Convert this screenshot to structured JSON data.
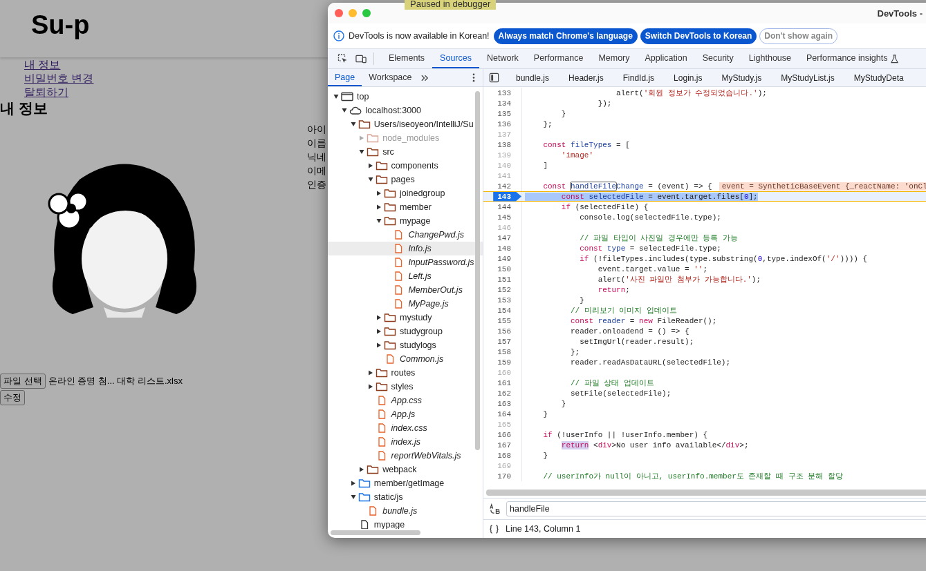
{
  "paused_banner": "Paused in debugger",
  "page": {
    "logo": "Su-p",
    "nav_links": [
      "내 정보",
      "비밀번호 변경",
      "탈퇴하기"
    ],
    "heading": "내 정보",
    "field_labels": [
      "아이",
      "이름",
      "닉네",
      "이메",
      "인증"
    ],
    "file_button": "파일 선택",
    "file_name": "온라인 증명 첨... 대학 리스트.xlsx",
    "submit_button": "수정"
  },
  "devtools": {
    "title": "DevTools -",
    "notice": {
      "text": "DevTools is now available in Korean!",
      "buttons": [
        {
          "label": "Always match Chrome's language",
          "kind": "primary"
        },
        {
          "label": "Switch DevTools to Korean",
          "kind": "primary"
        },
        {
          "label": "Don't show again",
          "kind": "outline"
        }
      ]
    },
    "tabs": [
      {
        "label": "Elements",
        "selected": false
      },
      {
        "label": "Sources",
        "selected": true
      },
      {
        "label": "Network",
        "selected": false
      },
      {
        "label": "Performance",
        "selected": false
      },
      {
        "label": "Memory",
        "selected": false
      },
      {
        "label": "Application",
        "selected": false
      },
      {
        "label": "Security",
        "selected": false
      },
      {
        "label": "Lighthouse",
        "selected": false
      },
      {
        "label": "Performance insights",
        "selected": false
      }
    ],
    "navigator_tabs": [
      {
        "label": "Page",
        "selected": true
      },
      {
        "label": "Workspace",
        "selected": false
      }
    ],
    "editor_tabs": [
      "bundle.js",
      "Header.js",
      "FindId.js",
      "Login.js",
      "MyStudy.js",
      "MyStudyList.js",
      "MyStudyDeta"
    ],
    "tree": [
      {
        "label": "top",
        "kind": "frame",
        "expanded": true,
        "selected": false,
        "dimmed": false,
        "children": [
          {
            "label": "localhost:3000",
            "kind": "cloud",
            "expanded": true,
            "selected": false,
            "dimmed": false,
            "children": [
              {
                "label": "Users/iseoyeon/IntelliJ/Su",
                "kind": "folder",
                "expanded": true,
                "selected": false,
                "dimmed": false,
                "children": [
                  {
                    "label": "node_modules",
                    "kind": "folder",
                    "expanded": false,
                    "selected": false,
                    "dimmed": true
                  },
                  {
                    "label": "src",
                    "kind": "folder",
                    "expanded": true,
                    "selected": false,
                    "dimmed": false,
                    "children": [
                      {
                        "label": "components",
                        "kind": "folder",
                        "expanded": false,
                        "selected": false,
                        "dimmed": false
                      },
                      {
                        "label": "pages",
                        "kind": "folder",
                        "expanded": true,
                        "selected": false,
                        "dimmed": false,
                        "children": [
                          {
                            "label": "joinedgroup",
                            "kind": "folder",
                            "expanded": false,
                            "selected": false,
                            "dimmed": false
                          },
                          {
                            "label": "member",
                            "kind": "folder",
                            "expanded": false,
                            "selected": false,
                            "dimmed": false
                          },
                          {
                            "label": "mypage",
                            "kind": "folder",
                            "expanded": true,
                            "selected": false,
                            "dimmed": false,
                            "children": [
                              {
                                "label": "ChangePwd.js",
                                "kind": "file",
                                "selected": false,
                                "dimmed": false
                              },
                              {
                                "label": "Info.js",
                                "kind": "file",
                                "selected": true,
                                "dimmed": false
                              },
                              {
                                "label": "InputPassword.js",
                                "kind": "file",
                                "selected": false,
                                "dimmed": false
                              },
                              {
                                "label": "Left.js",
                                "kind": "file",
                                "selected": false,
                                "dimmed": false
                              },
                              {
                                "label": "MemberOut.js",
                                "kind": "file",
                                "selected": false,
                                "dimmed": false
                              },
                              {
                                "label": "MyPage.js",
                                "kind": "file",
                                "selected": false,
                                "dimmed": false
                              }
                            ]
                          },
                          {
                            "label": "mystudy",
                            "kind": "folder",
                            "expanded": false,
                            "selected": false,
                            "dimmed": false
                          },
                          {
                            "label": "studygroup",
                            "kind": "folder",
                            "expanded": false,
                            "selected": false,
                            "dimmed": false
                          },
                          {
                            "label": "studylogs",
                            "kind": "folder",
                            "expanded": false,
                            "selected": false,
                            "dimmed": false
                          },
                          {
                            "label": "Common.js",
                            "kind": "file",
                            "selected": false,
                            "dimmed": false
                          }
                        ]
                      },
                      {
                        "label": "routes",
                        "kind": "folder",
                        "expanded": false,
                        "selected": false,
                        "dimmed": false
                      },
                      {
                        "label": "styles",
                        "kind": "folder",
                        "expanded": false,
                        "selected": false,
                        "dimmed": false
                      },
                      {
                        "label": "App.css",
                        "kind": "file",
                        "selected": false,
                        "dimmed": false
                      },
                      {
                        "label": "App.js",
                        "kind": "file",
                        "selected": false,
                        "dimmed": false
                      },
                      {
                        "label": "index.css",
                        "kind": "file",
                        "selected": false,
                        "dimmed": false
                      },
                      {
                        "label": "index.js",
                        "kind": "file",
                        "selected": false,
                        "dimmed": false
                      },
                      {
                        "label": "reportWebVitals.js",
                        "kind": "file",
                        "selected": false,
                        "dimmed": false
                      }
                    ]
                  },
                  {
                    "label": "webpack",
                    "kind": "folder",
                    "expanded": false,
                    "selected": false,
                    "dimmed": false
                  }
                ]
              },
              {
                "label": "member/getImage",
                "kind": "network-folder",
                "expanded": false,
                "selected": false,
                "dimmed": false
              },
              {
                "label": "static/js",
                "kind": "network-folder",
                "expanded": true,
                "selected": false,
                "dimmed": false,
                "children": [
                  {
                    "label": "bundle.js",
                    "kind": "file",
                    "selected": false,
                    "dimmed": false
                  }
                ]
              },
              {
                "label": "mypage",
                "kind": "document",
                "selected": false,
                "dimmed": false
              }
            ]
          }
        ]
      }
    ],
    "code": [
      {
        "number": "133",
        "muted": false,
        "paused": false,
        "segments": [
          {
            "kind": "plain",
            "text": "                    alert("
          },
          {
            "kind": "string",
            "text": "'회원 정보가 수정되었습니다.'"
          },
          {
            "kind": "plain",
            "text": ");"
          }
        ]
      },
      {
        "number": "134",
        "muted": false,
        "paused": false,
        "segments": [
          {
            "kind": "plain",
            "text": "                });"
          }
        ]
      },
      {
        "number": "135",
        "muted": false,
        "paused": false,
        "segments": [
          {
            "kind": "plain",
            "text": "        }"
          }
        ]
      },
      {
        "number": "136",
        "muted": false,
        "paused": false,
        "segments": [
          {
            "kind": "plain",
            "text": "    };"
          }
        ]
      },
      {
        "number": "137",
        "muted": true,
        "paused": false
      },
      {
        "number": "138",
        "muted": false,
        "paused": false,
        "segments": [
          {
            "kind": "keyword",
            "text": "    const"
          },
          {
            "kind": "definition",
            "text": " fileTypes"
          },
          {
            "kind": "plain",
            "text": " = ["
          }
        ]
      },
      {
        "number": "139",
        "muted": true,
        "paused": false,
        "segments": [
          {
            "kind": "string",
            "text": "        'image'"
          }
        ]
      },
      {
        "number": "140",
        "muted": true,
        "paused": false,
        "segments": [
          {
            "kind": "plain",
            "text": "    ]"
          }
        ]
      },
      {
        "number": "141",
        "muted": true,
        "paused": false
      },
      {
        "number": "142",
        "muted": false,
        "paused": false,
        "segments": [
          {
            "kind": "keyword",
            "text": "    const"
          },
          {
            "kind": "match",
            "text": " handleFile"
          },
          {
            "kind": "definition",
            "text": "Change"
          },
          {
            "kind": "plain",
            "text": " = (event) => {"
          }
        ],
        "inline_value": "event = SyntheticBaseEvent {_reactName: 'onCl"
      },
      {
        "number": "143",
        "muted": false,
        "paused": true,
        "segments": [
          {
            "kind": "keyword",
            "text": "        const"
          },
          {
            "kind": "definition",
            "text": " selectedFile"
          },
          {
            "kind": "plain",
            "text": " = event.target.files["
          },
          {
            "kind": "number",
            "text": "0"
          },
          {
            "kind": "plain",
            "text": "];"
          }
        ]
      },
      {
        "number": "144",
        "muted": false,
        "paused": false,
        "segments": [
          {
            "kind": "keyword",
            "text": "        if"
          },
          {
            "kind": "plain",
            "text": " (selectedFile) {"
          }
        ]
      },
      {
        "number": "145",
        "muted": false,
        "paused": false,
        "segments": [
          {
            "kind": "plain",
            "text": "            console.log(selectedFile.type);"
          }
        ]
      },
      {
        "number": "146",
        "muted": true,
        "paused": false
      },
      {
        "number": "147",
        "muted": false,
        "paused": false,
        "segments": [
          {
            "kind": "comment",
            "text": "            // 파일 타입이 사진일 경우에만 등록 가능"
          }
        ]
      },
      {
        "number": "148",
        "muted": false,
        "paused": false,
        "segments": [
          {
            "kind": "keyword",
            "text": "            const"
          },
          {
            "kind": "definition",
            "text": " type"
          },
          {
            "kind": "plain",
            "text": " = selectedFile.type;"
          }
        ]
      },
      {
        "number": "149",
        "muted": false,
        "paused": false,
        "segments": [
          {
            "kind": "keyword",
            "text": "            if"
          },
          {
            "kind": "plain",
            "text": " (!fileTypes.includes(type.substring("
          },
          {
            "kind": "number",
            "text": "0"
          },
          {
            "kind": "plain",
            "text": ",type.indexOf("
          },
          {
            "kind": "string",
            "text": "'/'"
          },
          {
            "kind": "plain",
            "text": ")))) {"
          }
        ]
      },
      {
        "number": "150",
        "muted": false,
        "paused": false,
        "segments": [
          {
            "kind": "plain",
            "text": "                event.target.value = "
          },
          {
            "kind": "string",
            "text": "''"
          },
          {
            "kind": "plain",
            "text": ";"
          }
        ]
      },
      {
        "number": "151",
        "muted": false,
        "paused": false,
        "segments": [
          {
            "kind": "plain",
            "text": "                alert("
          },
          {
            "kind": "string",
            "text": "'사진 파일만 첨부가 가능합니다.'"
          },
          {
            "kind": "plain",
            "text": ");"
          }
        ]
      },
      {
        "number": "152",
        "muted": false,
        "paused": false,
        "segments": [
          {
            "kind": "keyword",
            "text": "                return"
          },
          {
            "kind": "plain",
            "text": ";"
          }
        ]
      },
      {
        "number": "153",
        "muted": false,
        "paused": false,
        "segments": [
          {
            "kind": "plain",
            "text": "            }"
          }
        ]
      },
      {
        "number": "154",
        "muted": false,
        "paused": false,
        "segments": [
          {
            "kind": "comment",
            "text": "          // 미리보기 이미지 업데이트"
          }
        ]
      },
      {
        "number": "155",
        "muted": false,
        "paused": false,
        "segments": [
          {
            "kind": "keyword",
            "text": "          const"
          },
          {
            "kind": "definition",
            "text": " reader"
          },
          {
            "kind": "plain",
            "text": " = "
          },
          {
            "kind": "keyword",
            "text": "new"
          },
          {
            "kind": "plain",
            "text": " FileReader();"
          }
        ]
      },
      {
        "number": "156",
        "muted": false,
        "paused": false,
        "segments": [
          {
            "kind": "plain",
            "text": "          reader.onloadend = () => {"
          }
        ]
      },
      {
        "number": "157",
        "muted": false,
        "paused": false,
        "segments": [
          {
            "kind": "plain",
            "text": "            setImgUrl(reader.result);"
          }
        ]
      },
      {
        "number": "158",
        "muted": false,
        "paused": false,
        "segments": [
          {
            "kind": "plain",
            "text": "          };"
          }
        ]
      },
      {
        "number": "159",
        "muted": false,
        "paused": false,
        "segments": [
          {
            "kind": "plain",
            "text": "          reader.readAsDataURL(selectedFile);"
          }
        ]
      },
      {
        "number": "160",
        "muted": true,
        "paused": false
      },
      {
        "number": "161",
        "muted": false,
        "paused": false,
        "segments": [
          {
            "kind": "comment",
            "text": "          // 파일 상태 업데이트"
          }
        ]
      },
      {
        "number": "162",
        "muted": false,
        "paused": false,
        "segments": [
          {
            "kind": "plain",
            "text": "          setFile(selectedFile);"
          }
        ]
      },
      {
        "number": "163",
        "muted": false,
        "paused": false,
        "segments": [
          {
            "kind": "plain",
            "text": "        }"
          }
        ]
      },
      {
        "number": "164",
        "muted": false,
        "paused": false,
        "segments": [
          {
            "kind": "plain",
            "text": "    }"
          }
        ]
      },
      {
        "number": "165",
        "muted": true,
        "paused": false
      },
      {
        "number": "166",
        "muted": false,
        "paused": false,
        "segments": [
          {
            "kind": "keyword",
            "text": "    if"
          },
          {
            "kind": "plain",
            "text": " (!userInfo || !userInfo.member) {"
          }
        ]
      },
      {
        "number": "167",
        "muted": false,
        "paused": false,
        "segments": [
          {
            "kind": "highlight",
            "text": "        return"
          },
          {
            "kind": "plain",
            "text": " <"
          },
          {
            "kind": "keyword",
            "text": "div"
          },
          {
            "kind": "plain",
            "text": ">No user info available</"
          },
          {
            "kind": "keyword",
            "text": "div"
          },
          {
            "kind": "plain",
            "text": ">;"
          }
        ]
      },
      {
        "number": "168",
        "muted": false,
        "paused": false,
        "segments": [
          {
            "kind": "plain",
            "text": "    }"
          }
        ]
      },
      {
        "number": "169",
        "muted": true,
        "paused": false
      },
      {
        "number": "170",
        "muted": false,
        "paused": false,
        "segments": [
          {
            "kind": "comment",
            "text": "    // userInfo가 null이 아니고, userInfo.member도 존재할 때 구조 분해 할당"
          }
        ]
      }
    ],
    "search": {
      "value": "handleFile"
    },
    "status": "Line 143, Column 1"
  }
}
